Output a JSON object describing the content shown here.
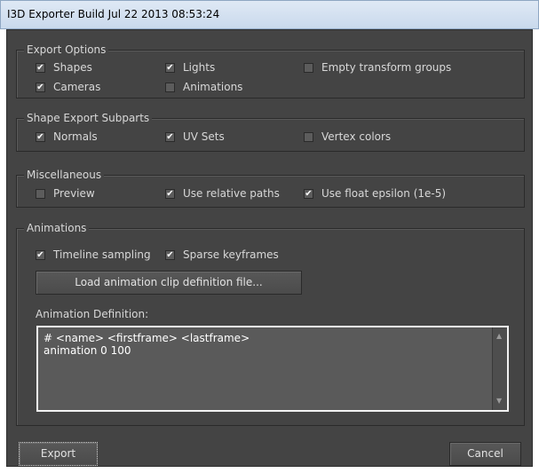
{
  "window": {
    "title": "I3D Exporter Build Jul 22 2013 08:53:24"
  },
  "export_options": {
    "legend": "Export Options",
    "shapes": {
      "label": "Shapes",
      "checked": true
    },
    "lights": {
      "label": "Lights",
      "checked": true
    },
    "empty_groups": {
      "label": "Empty transform groups",
      "checked": false
    },
    "cameras": {
      "label": "Cameras",
      "checked": true
    },
    "animations": {
      "label": "Animations",
      "checked": false
    }
  },
  "shape_subparts": {
    "legend": "Shape Export Subparts",
    "normals": {
      "label": "Normals",
      "checked": true
    },
    "uv_sets": {
      "label": "UV Sets",
      "checked": true
    },
    "vertex_colors": {
      "label": "Vertex colors",
      "checked": false
    }
  },
  "misc": {
    "legend": "Miscellaneous",
    "preview": {
      "label": "Preview",
      "checked": false
    },
    "relative_paths": {
      "label": "Use relative paths",
      "checked": true
    },
    "float_epsilon": {
      "label": "Use float epsilon (1e-5)",
      "checked": true
    }
  },
  "animations_group": {
    "legend": "Animations",
    "timeline_sampling": {
      "label": "Timeline sampling",
      "checked": true
    },
    "sparse_keyframes": {
      "label": "Sparse keyframes",
      "checked": true
    },
    "load_button": "Load animation clip definition file...",
    "definition_label": "Animation Definition:",
    "definition_lines": [
      "# <name> <firstframe> <lastframe>",
      "animation 0 100"
    ]
  },
  "footer": {
    "export_button": "Export",
    "cancel_button": "Cancel"
  },
  "colors": {
    "background": "#444444",
    "text": "#d8d8d8",
    "title_bar": "#d4e1f0",
    "textarea_border": "#f2f2f2"
  }
}
